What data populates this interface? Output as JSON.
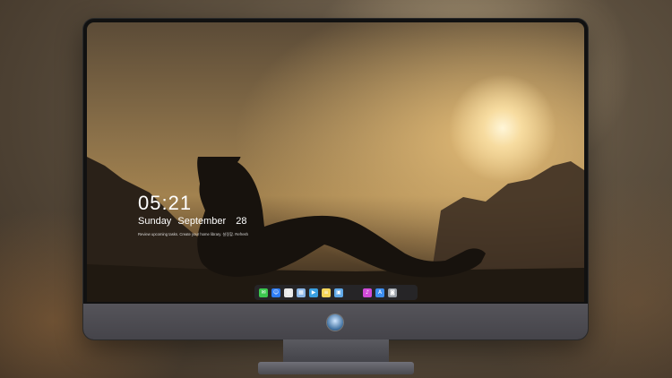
{
  "lock_screen": {
    "time": "05:21",
    "date": {
      "weekday": "Sunday",
      "month": "September",
      "day": "28"
    },
    "notification": "Review upcoming tasks. Create your home library. 설정할. Refresh"
  },
  "dock": {
    "items": [
      {
        "name": "messages-icon",
        "color": "#3cc84f",
        "glyph": "✉"
      },
      {
        "name": "finder-icon",
        "color": "#2d7cf6",
        "glyph": "☺"
      },
      {
        "name": "safari-icon",
        "color": "#e9e9e9",
        "glyph": "◎"
      },
      {
        "name": "preview-icon",
        "color": "#8db8e8",
        "glyph": "▦"
      },
      {
        "name": "claquette-icon",
        "color": "#3aa0e0",
        "glyph": "▶"
      },
      {
        "name": "notes-icon",
        "color": "#f6d65a",
        "glyph": "≡"
      },
      {
        "name": "photos-icon",
        "color": "#5fa8e8",
        "glyph": "▣"
      },
      {
        "name": "music-icon",
        "color": "#d04ad8",
        "glyph": "♪"
      },
      {
        "name": "app-store-icon",
        "color": "#3d8ef0",
        "glyph": "A"
      },
      {
        "name": "screenshot-icon",
        "color": "#9aa0a8",
        "glyph": "◙"
      }
    ]
  }
}
